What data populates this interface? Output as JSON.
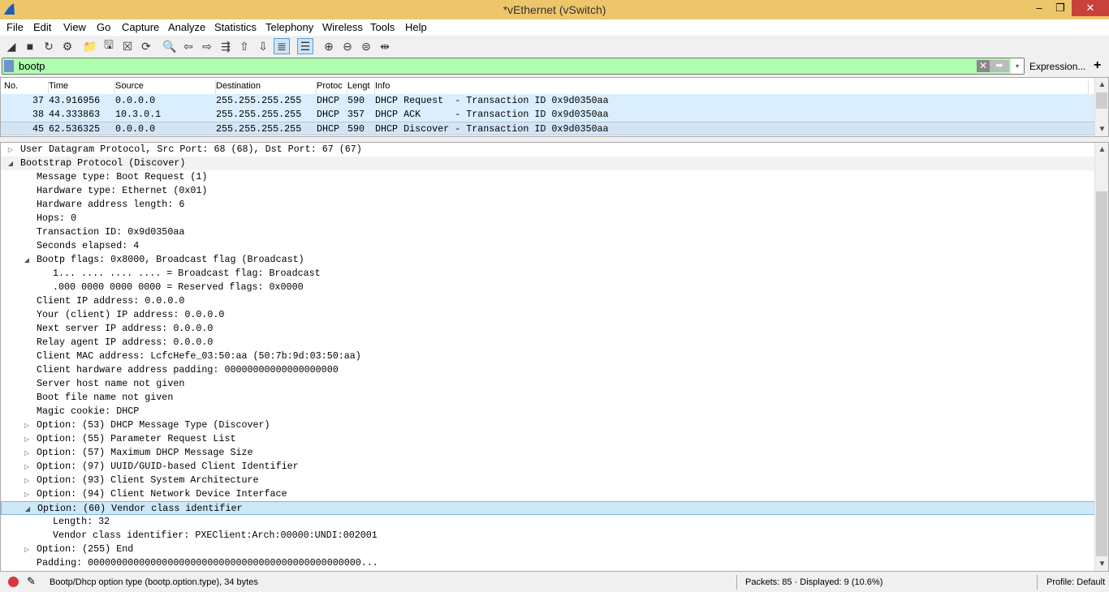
{
  "window": {
    "title": "*vEthernet (vSwitch)",
    "minimize": "‒",
    "restore": "❐",
    "close": "✕"
  },
  "menu": [
    "File",
    "Edit",
    "View",
    "Go",
    "Capture",
    "Analyze",
    "Statistics",
    "Telephony",
    "Wireless",
    "Tools",
    "Help"
  ],
  "toolbar": [
    {
      "icon": "shark-fin-start-icon",
      "glyph": "◢"
    },
    {
      "icon": "stop-icon",
      "glyph": "■"
    },
    {
      "icon": "restart-icon",
      "glyph": "↻"
    },
    {
      "icon": "capture-options-icon",
      "glyph": "⚙"
    },
    {
      "icon": "open-file-icon",
      "glyph": "📁"
    },
    {
      "icon": "save-file-icon",
      "glyph": "🖫"
    },
    {
      "icon": "close-file-icon",
      "glyph": "☒"
    },
    {
      "icon": "reload-icon",
      "glyph": "⟳"
    },
    {
      "icon": "find-packet-icon",
      "glyph": "🔍"
    },
    {
      "icon": "go-back-icon",
      "glyph": "⇦"
    },
    {
      "icon": "go-forward-icon",
      "glyph": "⇨"
    },
    {
      "icon": "go-to-packet-icon",
      "glyph": "⇶"
    },
    {
      "icon": "first-packet-icon",
      "glyph": "⇧"
    },
    {
      "icon": "last-packet-icon",
      "glyph": "⇩"
    },
    {
      "icon": "auto-scroll-icon",
      "glyph": "≣",
      "active": true
    },
    {
      "icon": "colorize-icon",
      "glyph": "☰",
      "active": true
    },
    {
      "icon": "zoom-in-icon",
      "glyph": "⊕"
    },
    {
      "icon": "zoom-out-icon",
      "glyph": "⊖"
    },
    {
      "icon": "zoom-normal-icon",
      "glyph": "⊜"
    },
    {
      "icon": "resize-columns-icon",
      "glyph": "⇹"
    }
  ],
  "filter": {
    "value": "bootp",
    "clear": "✕",
    "apply": "➡",
    "dropdown": "▾",
    "expression_label": "Expression...",
    "add": "+"
  },
  "packet_list": {
    "columns": [
      "No.",
      "Time",
      "Source",
      "Destination",
      "Protoc",
      "Lengt",
      "Info"
    ],
    "rows": [
      {
        "no": "37",
        "time": "43.916956",
        "source": "0.0.0.0",
        "destination": "255.255.255.255",
        "protocol": "DHCP",
        "length": "590",
        "info": "DHCP Request  - Transaction ID 0x9d0350aa"
      },
      {
        "no": "38",
        "time": "44.333863",
        "source": "10.3.0.1",
        "destination": "255.255.255.255",
        "protocol": "DHCP",
        "length": "357",
        "info": "DHCP ACK      - Transaction ID 0x9d0350aa"
      },
      {
        "no": "45",
        "time": "62.536325",
        "source": "0.0.0.0",
        "destination": "255.255.255.255",
        "protocol": "DHCP",
        "length": "590",
        "info": "DHCP Discover - Transaction ID 0x9d0350aa",
        "selected": true
      }
    ]
  },
  "detail_tree": [
    {
      "level": 0,
      "exp": "collapsed",
      "text": "User Datagram Protocol, Src Port: 68 (68), Dst Port: 67 (67)"
    },
    {
      "level": 0,
      "exp": "expanded",
      "text": "Bootstrap Protocol (Discover)",
      "hover": true
    },
    {
      "level": 1,
      "exp": "none",
      "text": "Message type: Boot Request (1)"
    },
    {
      "level": 1,
      "exp": "none",
      "text": "Hardware type: Ethernet (0x01)"
    },
    {
      "level": 1,
      "exp": "none",
      "text": "Hardware address length: 6"
    },
    {
      "level": 1,
      "exp": "none",
      "text": "Hops: 0"
    },
    {
      "level": 1,
      "exp": "none",
      "text": "Transaction ID: 0x9d0350aa"
    },
    {
      "level": 1,
      "exp": "none",
      "text": "Seconds elapsed: 4"
    },
    {
      "level": 1,
      "exp": "expanded",
      "text": "Bootp flags: 0x8000, Broadcast flag (Broadcast)"
    },
    {
      "level": 2,
      "exp": "none",
      "text": "1... .... .... .... = Broadcast flag: Broadcast"
    },
    {
      "level": 2,
      "exp": "none",
      "text": ".000 0000 0000 0000 = Reserved flags: 0x0000"
    },
    {
      "level": 1,
      "exp": "none",
      "text": "Client IP address: 0.0.0.0"
    },
    {
      "level": 1,
      "exp": "none",
      "text": "Your (client) IP address: 0.0.0.0"
    },
    {
      "level": 1,
      "exp": "none",
      "text": "Next server IP address: 0.0.0.0"
    },
    {
      "level": 1,
      "exp": "none",
      "text": "Relay agent IP address: 0.0.0.0"
    },
    {
      "level": 1,
      "exp": "none",
      "text": "Client MAC address: LcfcHefe_03:50:aa (50:7b:9d:03:50:aa)"
    },
    {
      "level": 1,
      "exp": "none",
      "text": "Client hardware address padding: 00000000000000000000"
    },
    {
      "level": 1,
      "exp": "none",
      "text": "Server host name not given"
    },
    {
      "level": 1,
      "exp": "none",
      "text": "Boot file name not given"
    },
    {
      "level": 1,
      "exp": "none",
      "text": "Magic cookie: DHCP"
    },
    {
      "level": 1,
      "exp": "collapsed",
      "text": "Option: (53) DHCP Message Type (Discover)"
    },
    {
      "level": 1,
      "exp": "collapsed",
      "text": "Option: (55) Parameter Request List"
    },
    {
      "level": 1,
      "exp": "collapsed",
      "text": "Option: (57) Maximum DHCP Message Size"
    },
    {
      "level": 1,
      "exp": "collapsed",
      "text": "Option: (97) UUID/GUID-based Client Identifier"
    },
    {
      "level": 1,
      "exp": "collapsed",
      "text": "Option: (93) Client System Architecture"
    },
    {
      "level": 1,
      "exp": "collapsed",
      "text": "Option: (94) Client Network Device Interface"
    },
    {
      "level": 1,
      "exp": "expanded",
      "text": "Option: (60) Vendor class identifier",
      "selected": true
    },
    {
      "level": 2,
      "exp": "none",
      "text": "Length: 32"
    },
    {
      "level": 2,
      "exp": "none",
      "text": "Vendor class identifier: PXEClient:Arch:00000:UNDI:002001"
    },
    {
      "level": 1,
      "exp": "collapsed",
      "text": "Option: (255) End"
    },
    {
      "level": 1,
      "exp": "none",
      "text": "Padding: 000000000000000000000000000000000000000000000000..."
    }
  ],
  "status": {
    "field_info": "Bootp/Dhcp option type (bootp.option.type), 34 bytes",
    "packets": "Packets: 85 · Displayed: 9 (10.6%)",
    "profile": "Profile: Default",
    "record_color": "#d9383a"
  }
}
